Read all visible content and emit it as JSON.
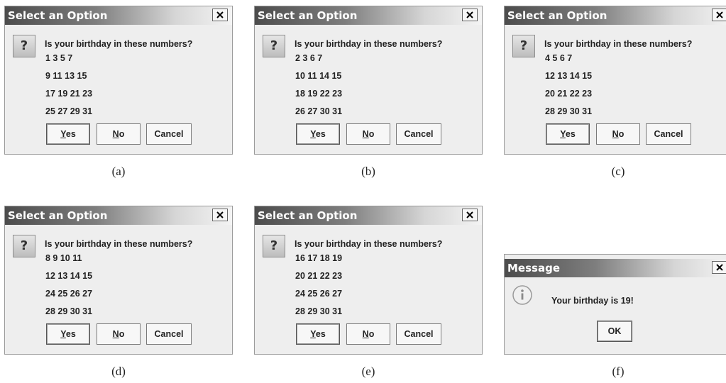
{
  "dialog_title": "Select an Option",
  "prompt": "Is your birthday in these numbers?",
  "buttons": {
    "yes": "Yes",
    "no": "No",
    "cancel": "Cancel",
    "ok": "OK"
  },
  "dialogs": {
    "a": {
      "caption": "(a)",
      "rows": [
        "1 3 5 7",
        "9 11 13 15",
        "17 19 21 23",
        "25 27 29 31"
      ]
    },
    "b": {
      "caption": "(b)",
      "rows": [
        "2 3 6 7",
        "10 11 14 15",
        "18 19 22 23",
        "26 27 30 31"
      ]
    },
    "c": {
      "caption": "(c)",
      "rows": [
        "4 5 6 7",
        "12 13 14 15",
        "20 21 22 23",
        "28 29 30 31"
      ]
    },
    "d": {
      "caption": "(d)",
      "rows": [
        "8 9 10 11",
        "12 13 14 15",
        "24 25 26 27",
        "28 29 30 31"
      ]
    },
    "e": {
      "caption": "(e)",
      "rows": [
        "16 17 18 19",
        "20 21 22 23",
        "24 25 26 27",
        "28 29 30 31"
      ]
    }
  },
  "message": {
    "title": "Message",
    "text": "Your birthday is 19!",
    "caption": "(f)"
  },
  "icons": {
    "question": "question-icon",
    "info": "info-icon",
    "close": "close-icon"
  },
  "colors": {
    "dialog_bg": "#eeeeee",
    "title_gradient_start": "#4c4c4c",
    "title_gradient_end": "#f4f4f4"
  }
}
